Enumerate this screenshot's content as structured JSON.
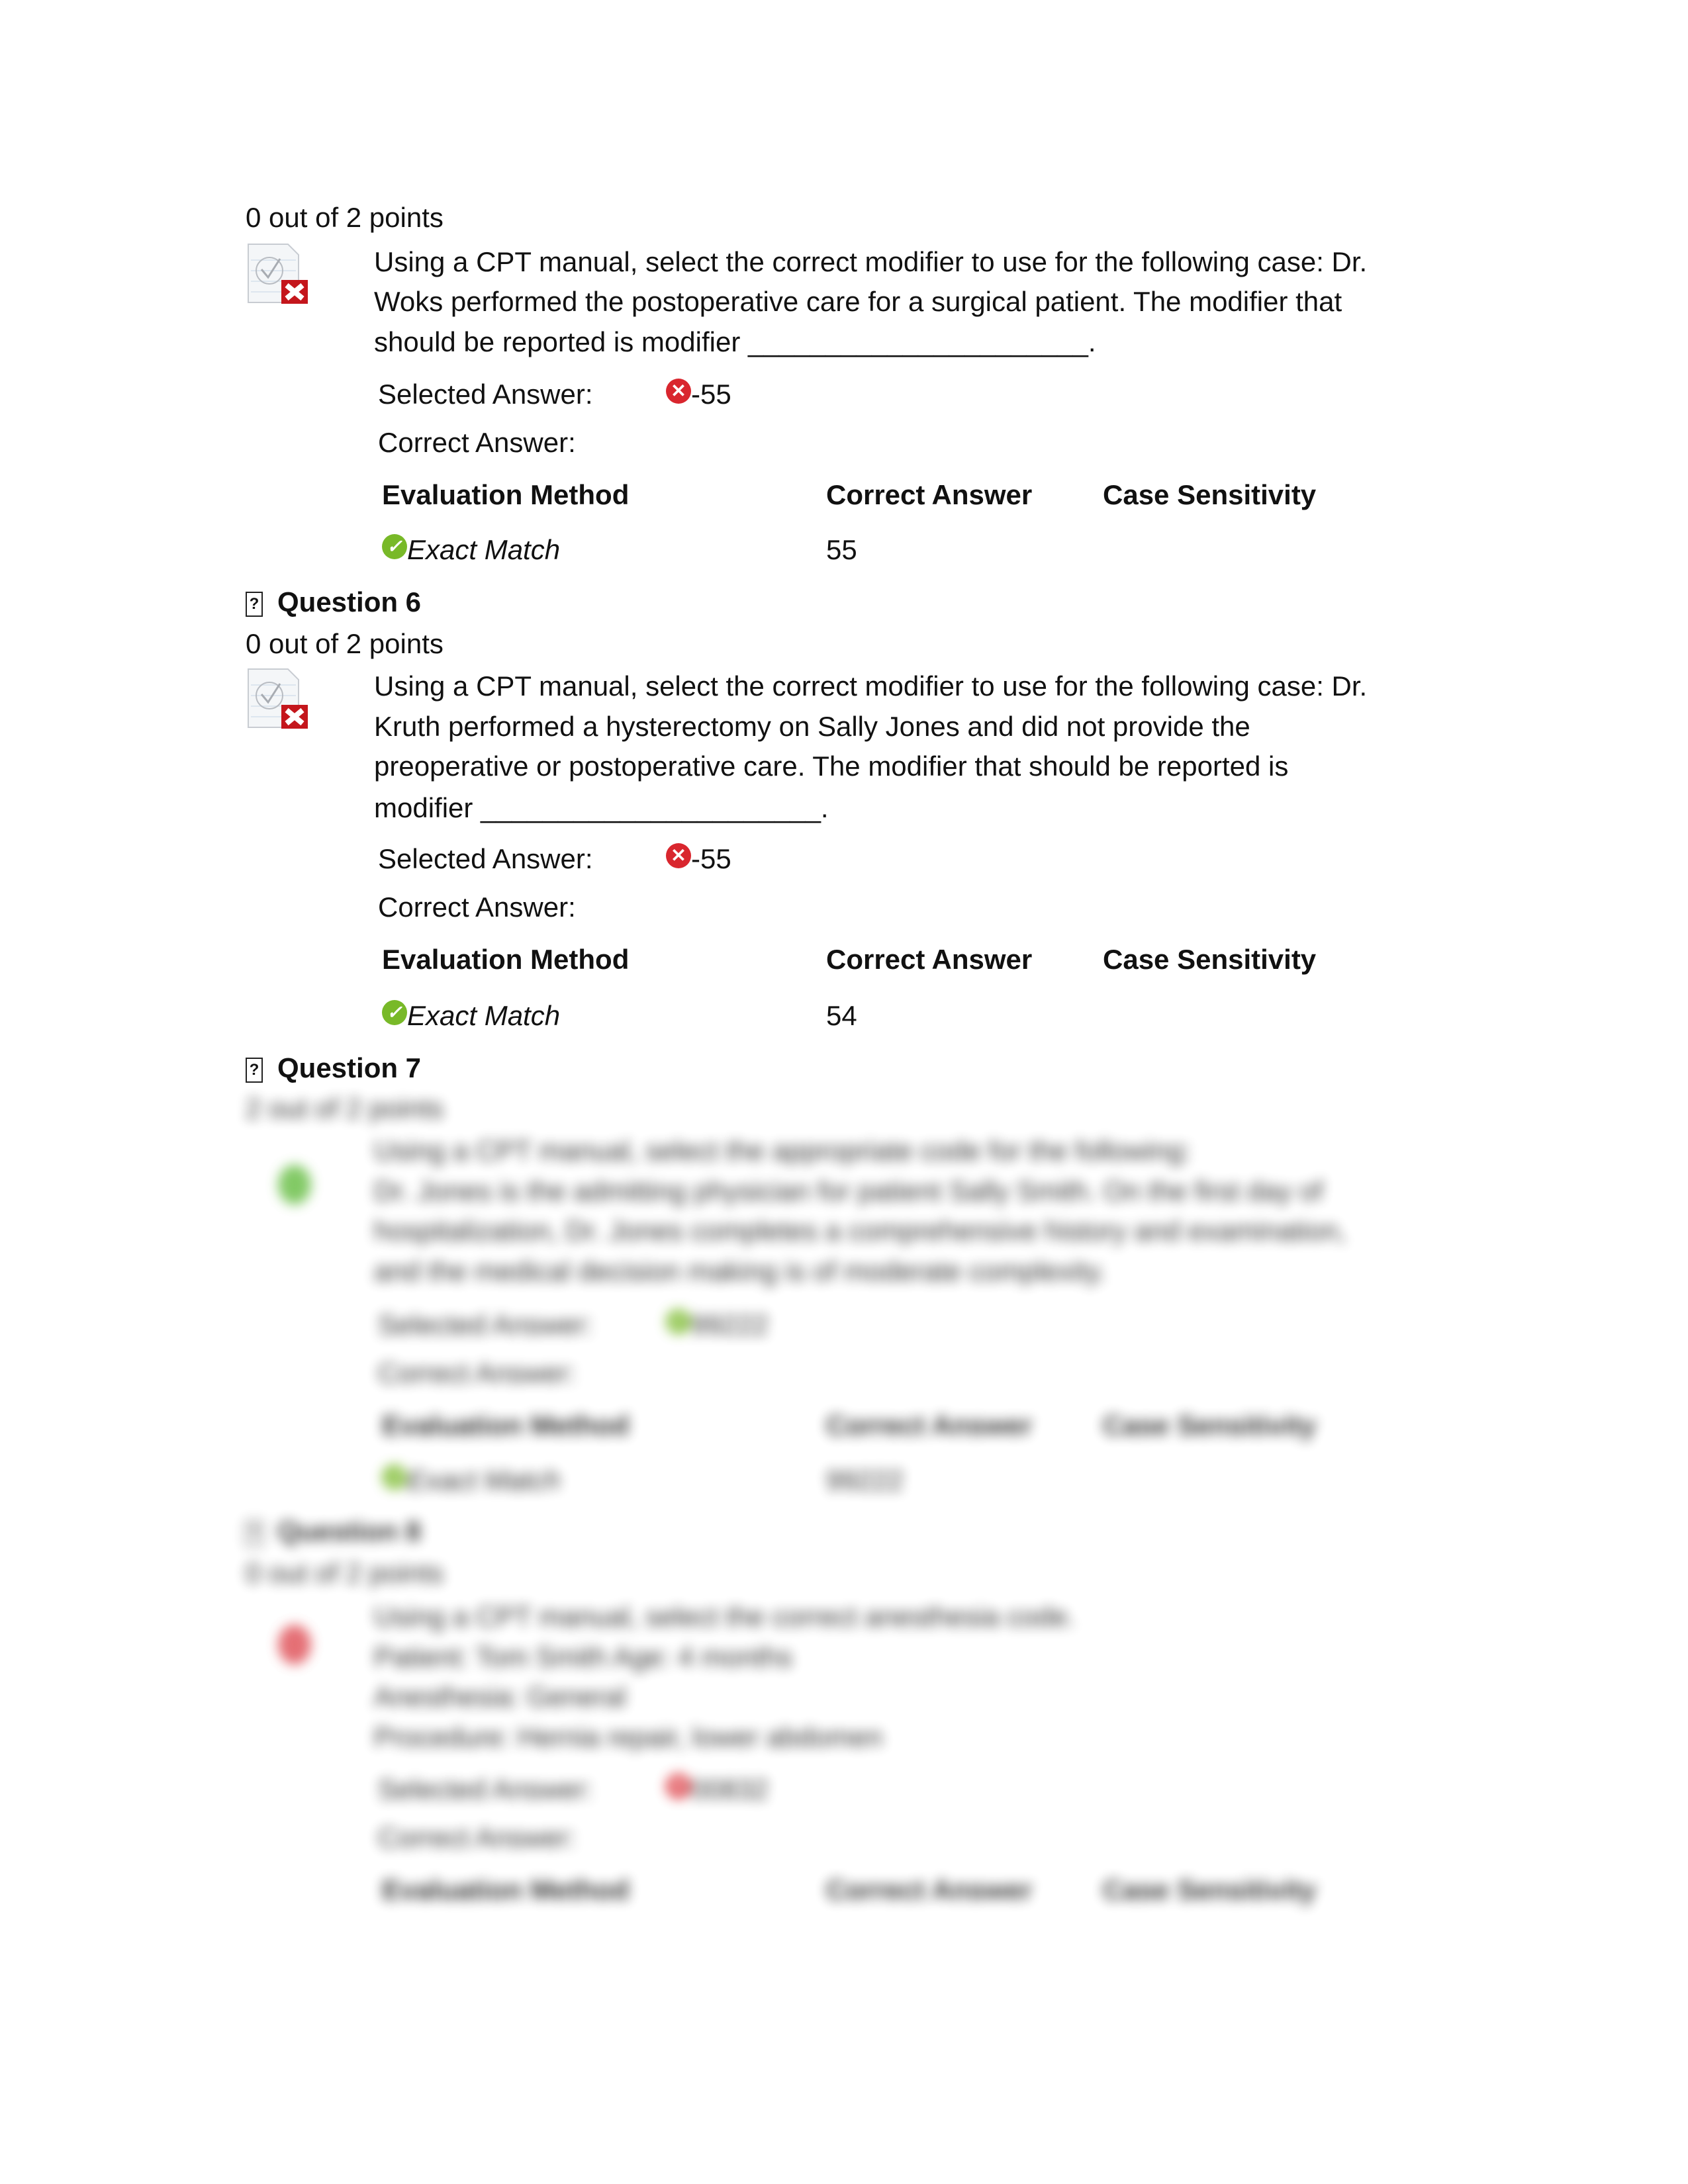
{
  "questions": [
    {
      "title": "",
      "points": "0 out of 2 points",
      "status": "incorrect",
      "text_lines": [
        "Using a CPT manual, select the correct modifier to use for the following case: Dr.",
        "Woks performed the postoperative care for a surgical patient. The modifier that",
        "should be reported is modifier ______________________."
      ],
      "selected_label": "Selected Answer:",
      "selected_value": "-55",
      "correct_label": "Correct Answer:",
      "table_headers": [
        "Evaluation Method",
        "Correct Answer",
        "Case Sensitivity"
      ],
      "eval_method": "Exact Match",
      "correct_value": "55"
    },
    {
      "title": "Question 6",
      "points": "0 out of 2 points",
      "status": "incorrect",
      "text_lines": [
        "Using a CPT manual, select the correct modifier to use for the following case: Dr.",
        "Kruth performed a hysterectomy on Sally Jones and did not provide the",
        "preoperative or postoperative care. The modifier that should be reported is",
        "modifier ______________________."
      ],
      "selected_label": "Selected Answer:",
      "selected_value": "-55",
      "correct_label": "Correct Answer:",
      "table_headers": [
        "Evaluation Method",
        "Correct Answer",
        "Case Sensitivity"
      ],
      "eval_method": "Exact Match",
      "correct_value": "54"
    },
    {
      "title": "Question 7",
      "points": "2 out of 2 points",
      "status": "correct",
      "text_lines": [
        "Using a CPT manual, select the appropriate code for the following:",
        "Dr. Jones is the admitting physician for patient Sally Smith. On the first day of",
        "hospitalization, Dr. Jones completes a comprehensive history and examination,",
        "and the medical decision making is of moderate complexity."
      ],
      "selected_label": "Selected Answer:",
      "selected_value": "99222",
      "correct_label": "Correct Answer:",
      "table_headers": [
        "Evaluation Method",
        "Correct Answer",
        "Case Sensitivity"
      ],
      "eval_method": "Exact Match",
      "correct_value": "99222"
    },
    {
      "title": "Question 8",
      "points": "0 out of 2 points",
      "status": "incorrect",
      "text_lines": [
        "Using a CPT manual, select the correct anesthesia code.",
        "Patient: Tom Smith Age: 4 months",
        "Anesthesia: General",
        "Procedure: Hernia repair, lower abdomen"
      ],
      "selected_label": "Selected Answer:",
      "selected_value": "00832",
      "correct_label": "Correct Answer:",
      "table_headers": [
        "Evaluation Method",
        "Correct Answer",
        "Case Sensitivity"
      ]
    }
  ],
  "colors": {
    "incorrect": "#d9262e",
    "correct": "#78b928"
  }
}
